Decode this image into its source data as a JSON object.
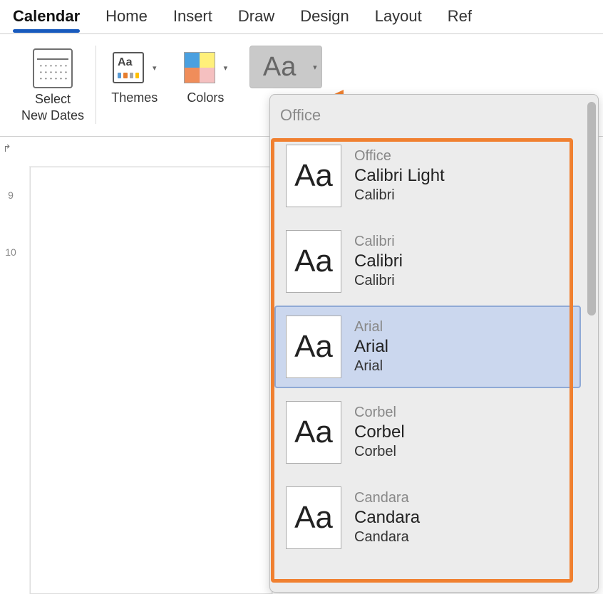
{
  "tabs": {
    "calendar": "Calendar",
    "home": "Home",
    "insert": "Insert",
    "draw": "Draw",
    "design": "Design",
    "layout": "Layout",
    "ref_partial": "Ref"
  },
  "toolbar": {
    "selectDates": "Select\nNew Dates",
    "themes": "Themes",
    "colors": "Colors"
  },
  "dropdown": {
    "header": "Office",
    "options": [
      {
        "name": "Office",
        "major": "Calibri Light",
        "minor": "Calibri",
        "selected": false
      },
      {
        "name": "Calibri",
        "major": "Calibri",
        "minor": "Calibri",
        "selected": false
      },
      {
        "name": "Arial",
        "major": "Arial",
        "minor": "Arial",
        "selected": true
      },
      {
        "name": "Corbel",
        "major": "Corbel",
        "minor": "Corbel",
        "selected": false
      },
      {
        "name": "Candara",
        "major": "Candara",
        "minor": "Candara",
        "selected": false
      }
    ]
  },
  "swatchText": "Aa",
  "ruler": {
    "marks": [
      "9",
      "10"
    ]
  }
}
